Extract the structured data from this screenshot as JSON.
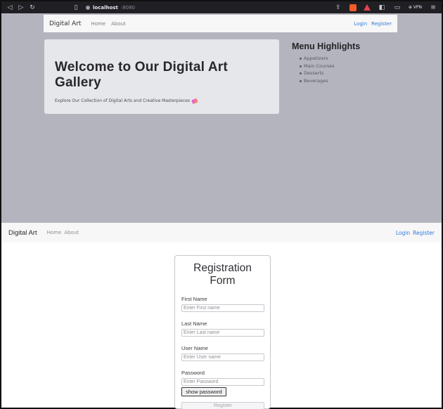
{
  "browser": {
    "url_host": "localhost",
    "url_port": ":8080",
    "vpn_label": "⊕ VPN"
  },
  "overlay": {
    "navbar": {
      "brand": "Digital Art",
      "links": [
        "Home",
        "About"
      ],
      "login": "Login",
      "register": "Register"
    },
    "jumbotron": {
      "title": "Welcome to Our Digital Art Gallery",
      "subtitle": "Explore Our Collection of Digital Arts and Creative Masterpieces"
    },
    "menu_highlights": {
      "title": "Menu Highlights",
      "items": [
        "Appetizers",
        "Main Courses",
        "Desserts",
        "Beverages"
      ]
    }
  },
  "navbar": {
    "brand": "Digital Art",
    "links": [
      "Home",
      "About"
    ],
    "login": "Login",
    "register": "Register"
  },
  "registration": {
    "title": "Registration Form",
    "fields": [
      {
        "label": "First Name",
        "placeholder": "Enter First name"
      },
      {
        "label": "Last Name",
        "placeholder": "Enter Last name"
      },
      {
        "label": "User Name",
        "placeholder": "Enter User name"
      },
      {
        "label": "Password",
        "placeholder": "Enter Password"
      }
    ],
    "show_password": "show password",
    "register_button": "Register"
  },
  "colors": {
    "link": "#2f7bdc",
    "overlay": "#b3b4bd",
    "browser_bar": "#1f1f24"
  }
}
